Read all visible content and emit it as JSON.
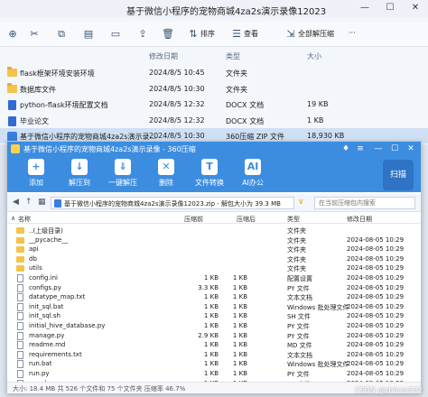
{
  "explorer": {
    "title": "基于微信小程序的宠物商城4za2s演示录像12023",
    "toolbar": {
      "sort_label": "排序",
      "view_label": "查看",
      "extract_all_label": "全部解压缩",
      "more_label": "···"
    },
    "columns": {
      "modified": "修改日期",
      "type": "类型",
      "size": "大小"
    },
    "rows": [
      {
        "name": "flask框架环境安装环境",
        "date": "2024/8/5 10:45",
        "type": "文件夹",
        "size": "",
        "icon": "folder-icon"
      },
      {
        "name": "数据库文件",
        "date": "2024/8/5 10:30",
        "type": "文件夹",
        "size": "",
        "icon": "folder-icon"
      },
      {
        "name": "python-flask环境配置文档",
        "date": "2024/8/5 12:32",
        "type": "DOCX 文档",
        "size": "19 KB",
        "icon": "docx-icon"
      },
      {
        "name": "毕业论文",
        "date": "2024/8/5 12:32",
        "type": "DOCX 文档",
        "size": "1 KB",
        "icon": "docx-icon"
      },
      {
        "name": "基于微信小程序的宠物商城4za2s演示录...",
        "date": "2024/8/5 10:30",
        "type": "360压缩 ZIP 文件",
        "size": "18,930 KB",
        "icon": "zip-icon"
      }
    ]
  },
  "zip": {
    "title": "基于微信小程序的宠物商城4za2s演示录像 - 360压缩",
    "toolbar": [
      {
        "label": "添加",
        "icon": "add-icon"
      },
      {
        "label": "解压到",
        "icon": "extract-to-icon"
      },
      {
        "label": "一键解压",
        "icon": "one-click-extract-icon"
      },
      {
        "label": "删除",
        "icon": "delete-icon"
      },
      {
        "label": "文件转换",
        "icon": "convert-icon"
      },
      {
        "label": "AI办公",
        "icon": "ai-icon"
      }
    ],
    "scan_label": "扫描",
    "address": "基于微信小程序的宠物商城4za2s演示录像12023.zip - 解包大小为 39.3 MB",
    "search_placeholder": "在当前压缩包内搜索",
    "columns": {
      "name": "名称",
      "compressed": "压缩前",
      "size": "压缩后",
      "type": "类型",
      "modified": "修改日期"
    },
    "rows": [
      {
        "name": "..(上级目录)",
        "before": "",
        "after": "",
        "type": "文件夹",
        "date": "",
        "folder": true
      },
      {
        "name": "__pycache__",
        "before": "",
        "after": "",
        "type": "文件夹",
        "date": "2024-08-05 10:29",
        "folder": true
      },
      {
        "name": "api",
        "before": "",
        "after": "",
        "type": "文件夹",
        "date": "2024-08-05 10:29",
        "folder": true
      },
      {
        "name": "db",
        "before": "",
        "after": "",
        "type": "文件夹",
        "date": "2024-08-05 10:29",
        "folder": true
      },
      {
        "name": "utils",
        "before": "",
        "after": "",
        "type": "文件夹",
        "date": "2024-08-05 10:29",
        "folder": true
      },
      {
        "name": "config.ini",
        "before": "1 KB",
        "after": "1 KB",
        "type": "配置设置",
        "date": "2024-08-05 10:29",
        "folder": false
      },
      {
        "name": "configs.py",
        "before": "3.3 KB",
        "after": "1 KB",
        "type": "PY 文件",
        "date": "2024-08-05 10:29",
        "folder": false
      },
      {
        "name": "datatype_map.txt",
        "before": "1 KB",
        "after": "1 KB",
        "type": "文本文档",
        "date": "2024-08-05 10:29",
        "folder": false
      },
      {
        "name": "init_sql.bat",
        "before": "1 KB",
        "after": "1 KB",
        "type": "Windows 批处理文件",
        "date": "2024-08-05 10:29",
        "folder": false
      },
      {
        "name": "init_sql.sh",
        "before": "1 KB",
        "after": "1 KB",
        "type": "SH 文件",
        "date": "2024-08-05 10:29",
        "folder": false
      },
      {
        "name": "initial_hive_database.py",
        "before": "1 KB",
        "after": "1 KB",
        "type": "PY 文件",
        "date": "2024-08-05 10:29",
        "folder": false
      },
      {
        "name": "manage.py",
        "before": "2.9 KB",
        "after": "1 KB",
        "type": "PY 文件",
        "date": "2024-08-05 10:29",
        "folder": false
      },
      {
        "name": "readme.md",
        "before": "1 KB",
        "after": "1 KB",
        "type": "MD 文件",
        "date": "2024-08-05 10:29",
        "folder": false
      },
      {
        "name": "requirements.txt",
        "before": "1 KB",
        "after": "1 KB",
        "type": "文本文档",
        "date": "2024-08-05 10:29",
        "folder": false
      },
      {
        "name": "run.bat",
        "before": "1 KB",
        "after": "1 KB",
        "type": "Windows 批处理文件",
        "date": "2024-08-05 10:29",
        "folder": false
      },
      {
        "name": "run.py",
        "before": "1 KB",
        "after": "1 KB",
        "type": "PY 文件",
        "date": "2024-08-05 10:29",
        "folder": false
      },
      {
        "name": "run.sh",
        "before": "1 KB",
        "after": "1 KB",
        "type": "SH 文件",
        "date": "2024-08-05 10:29",
        "folder": false
      }
    ],
    "status": "大小: 18.4 MB 共 526 个文件和 75 个文件夹 压缩率 46.7%"
  },
  "watermark": "CSDN @zhiheo502",
  "colors": {
    "accent": "#3c8de0",
    "selection": "#cfe0f5",
    "folder": "#f3c34a"
  }
}
